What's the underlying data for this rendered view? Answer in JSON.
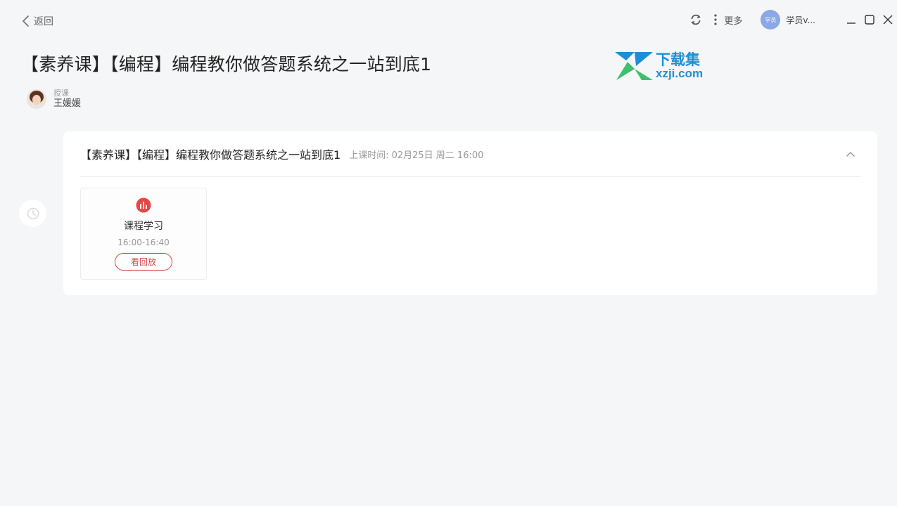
{
  "nav": {
    "back_label": "返回"
  },
  "toolbar": {
    "more_label": "更多",
    "user_name": "学员v...",
    "user_avatar_text": "学员"
  },
  "page": {
    "title": "【素养课】【编程】编程教你做答题系统之一站到底1"
  },
  "watermark": {
    "top_text": "下载集",
    "bottom_text": "xzji.com"
  },
  "teacher": {
    "label": "授课",
    "name": "王媛媛"
  },
  "course": {
    "title": "【素养课】【编程】编程教你做答题系统之一站到底1",
    "time_label": "上课时间:",
    "time_value": "02月25日 周二 16:00",
    "sessions": [
      {
        "name": "课程学习",
        "time": "16:00-16:40",
        "action": "看回放"
      }
    ]
  },
  "colors": {
    "accent": "#d64545",
    "background": "#f5f6f8",
    "watermark_blue": "#1e8fd6",
    "watermark_green": "#3fbf6f"
  }
}
